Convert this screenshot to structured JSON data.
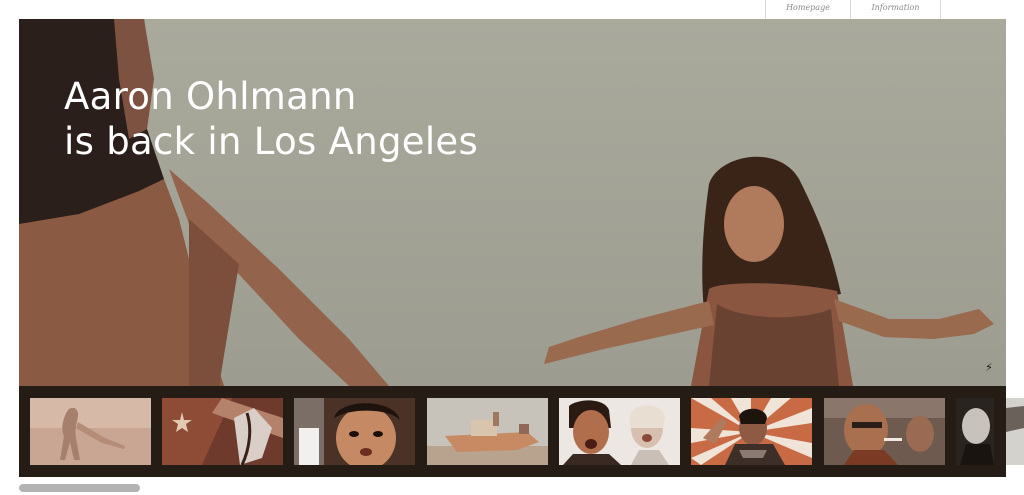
{
  "nav": {
    "items": [
      "Homepage",
      "Information"
    ]
  },
  "hero": {
    "headline_line1": "Aaron Ohlmann",
    "headline_line2": "is back in Los Angeles"
  },
  "icons": {
    "corner": "lightning-icon"
  },
  "thumbnails": [
    {
      "name": "thumb-1",
      "subject": "dancer"
    },
    {
      "name": "thumb-2",
      "subject": "flag"
    },
    {
      "name": "thumb-3",
      "subject": "child"
    },
    {
      "name": "thumb-4",
      "subject": "boat"
    },
    {
      "name": "thumb-5",
      "subject": "two-faces"
    },
    {
      "name": "thumb-6",
      "subject": "sunburst-man"
    },
    {
      "name": "thumb-7",
      "subject": "old-man"
    },
    {
      "name": "thumb-8",
      "subject": "partial"
    }
  ],
  "colors": {
    "strip": "#261c16",
    "hero_bg": "#a3a397",
    "text": "#ffffff"
  }
}
